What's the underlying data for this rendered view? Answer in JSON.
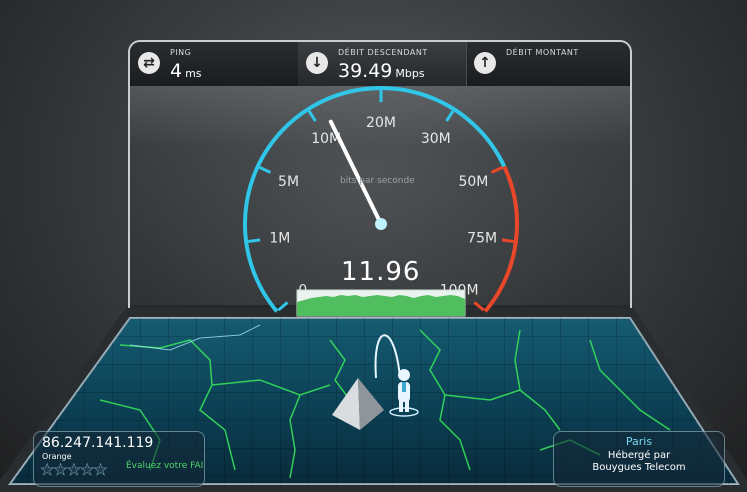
{
  "ping": {
    "label": "PING",
    "value": "4",
    "unit": "ms",
    "icon": "ping-icon"
  },
  "download": {
    "label": "DÉBIT DESCENDANT",
    "value": "39.49",
    "unit": "Mbps",
    "icon": "arrow-down-icon"
  },
  "upload": {
    "label": "DÉBIT MONTANT",
    "value": "",
    "icon": "arrow-up-icon"
  },
  "gauge": {
    "caption": "bits par seconde",
    "current": "11.96",
    "ticks": [
      {
        "t": "0",
        "m": 0
      },
      {
        "t": "1M",
        "m": 1
      },
      {
        "t": "5M",
        "m": 5
      },
      {
        "t": "10M",
        "m": 10
      },
      {
        "t": "20M",
        "m": 20
      },
      {
        "t": "30M",
        "m": 30
      },
      {
        "t": "50M",
        "m": 50
      },
      {
        "t": "75M",
        "m": 75
      },
      {
        "t": "100M",
        "m": 100
      }
    ],
    "accent": "#2fc6e8",
    "hot": "#e8472a"
  },
  "client": {
    "ip": "86.247.141.119",
    "isp": "Orange",
    "rate_label": "Évaluez votre FAI",
    "stars": 5
  },
  "server": {
    "city": "Paris",
    "hosted_label": "Hébergé par",
    "host": "Bouygues Telecom"
  }
}
